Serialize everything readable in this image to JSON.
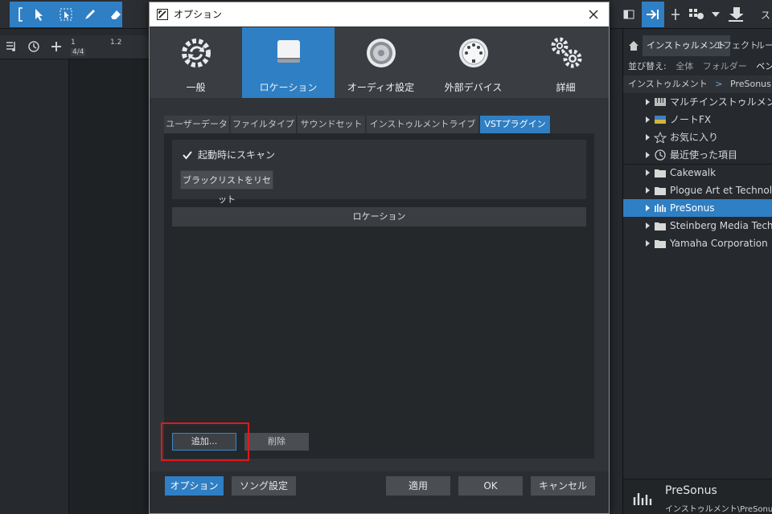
{
  "daw": {
    "ruler": {
      "bar1": "1",
      "bar12": "1.2",
      "timesig": "4/4"
    }
  },
  "browser": {
    "tabs": [
      "インストゥルメント",
      "エフェクト",
      "ルーブ"
    ],
    "sort_label": "並び替え:",
    "sort_options": [
      "全体",
      "フォルダー",
      "ベンダー"
    ],
    "crumb": [
      "インストゥルメント",
      ">",
      "PreSonus",
      ">"
    ],
    "items": [
      {
        "label": "マルチインストゥルメント",
        "icon": "multi-instrument-icon"
      },
      {
        "label": "ノートFX",
        "icon": "note-fx-icon"
      },
      {
        "label": "お気に入り",
        "icon": "star-icon"
      },
      {
        "label": "最近使った項目",
        "icon": "clock-icon"
      },
      {
        "label": "Cakewalk",
        "icon": "folder-icon"
      },
      {
        "label": "Plogue Art et Technologie",
        "icon": "folder-icon"
      },
      {
        "label": "PreSonus",
        "icon": "presonus-icon",
        "selected": true
      },
      {
        "label": "Steinberg Media Technologies",
        "icon": "folder-icon"
      },
      {
        "label": "Yamaha Corporation",
        "icon": "folder-icon"
      }
    ],
    "footer": {
      "title": "PreSonus",
      "path": "インストゥルメント\\PreSonus"
    },
    "toolbar_truncated_label": "ス"
  },
  "dialog": {
    "title": "オプション",
    "categories": [
      {
        "label": "一般",
        "icon": "sync-gear-icon"
      },
      {
        "label": "ロケーション",
        "icon": "drive-icon",
        "active": true
      },
      {
        "label": "オーディオ設定",
        "icon": "speaker-icon"
      },
      {
        "label": "外部デバイス",
        "icon": "midi-port-icon"
      },
      {
        "label": "詳細",
        "icon": "gears-icon"
      }
    ],
    "subtabs": [
      {
        "label": "ユーザーデータ"
      },
      {
        "label": "ファイルタイプ"
      },
      {
        "label": "サウンドセット"
      },
      {
        "label": "インストゥルメントライブラリ"
      },
      {
        "label": "VSTプラグイン",
        "active": true
      }
    ],
    "scan_on_start": {
      "label": "起動時にスキャン",
      "checked": true
    },
    "reset_blacklist": "ブラックリストをリセット",
    "location_header": "ロケーション",
    "add_button": "追加...",
    "delete_button": "削除",
    "footer": {
      "options": "オプション",
      "song_settings": "ソング設定",
      "apply": "適用",
      "ok": "OK",
      "cancel": "キャンセル"
    }
  },
  "colors": {
    "accent": "#2f7fc4",
    "highlight_annotation": "#e0191e"
  }
}
